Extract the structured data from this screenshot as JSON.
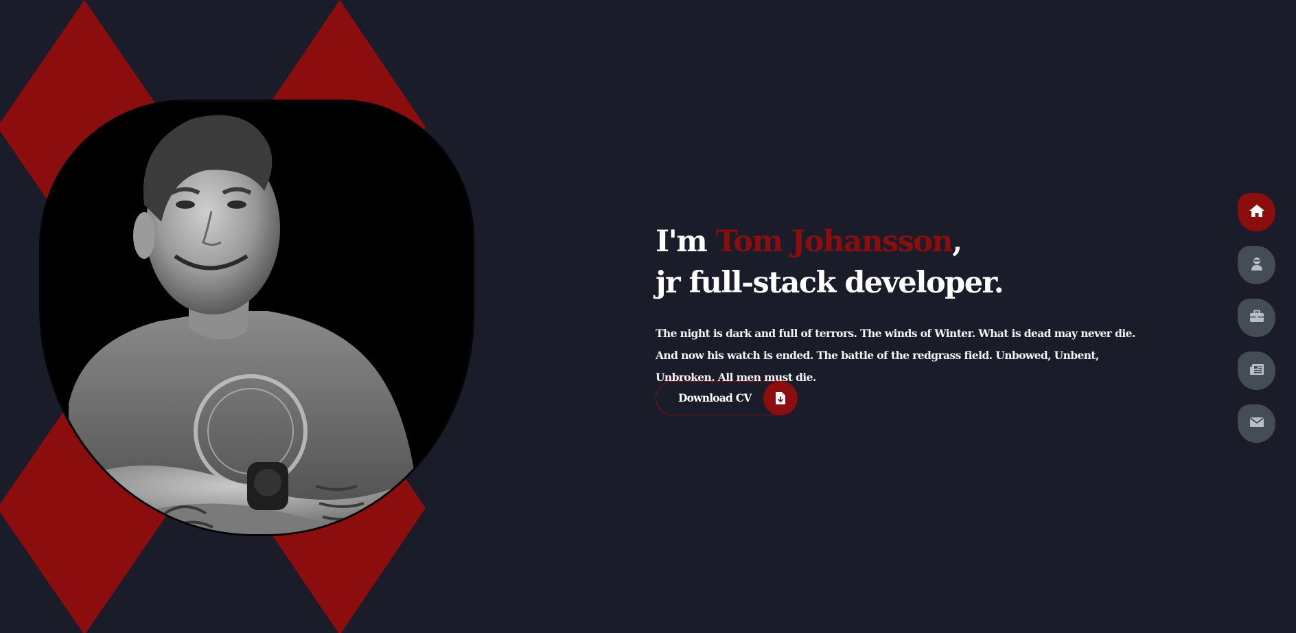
{
  "hero": {
    "greeting": "I'm ",
    "name": "Tom Johansson",
    "comma": ",",
    "role": "jr full-stack developer.",
    "description": "The night is dark and full of terrors. The winds of Winter. What is dead may never die. And now his watch is ended. The battle of the redgrass field. Unbowed, Unbent, Unbroken. All men must die."
  },
  "cv_button": {
    "label": "Download CV",
    "icon": "file-download-icon"
  },
  "side_nav": {
    "items": [
      {
        "icon": "home-icon",
        "active": true
      },
      {
        "icon": "user-icon",
        "active": false
      },
      {
        "icon": "briefcase-icon",
        "active": false
      },
      {
        "icon": "newspaper-icon",
        "active": false
      },
      {
        "icon": "envelope-icon",
        "active": false
      }
    ]
  },
  "colors": {
    "background": "#1a1c29",
    "accent": "#8b0d0d",
    "nav_inactive": "#444c55",
    "text": "#ffffff"
  }
}
